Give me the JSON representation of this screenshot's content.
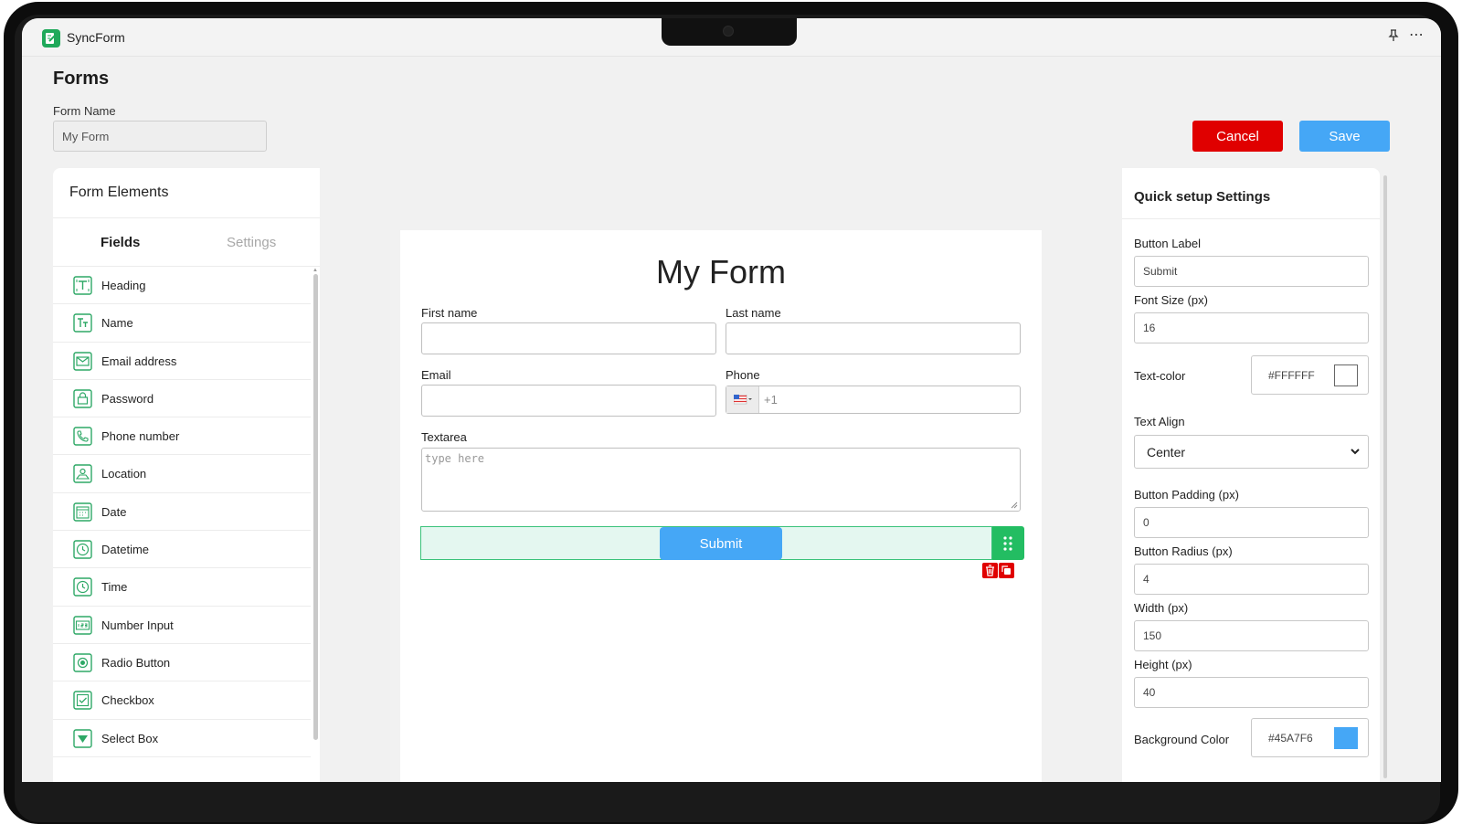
{
  "app": {
    "name": "SyncForm"
  },
  "page": {
    "title": "Forms",
    "form_name_label": "Form Name",
    "form_name_value": "My Form"
  },
  "actions": {
    "cancel_label": "Cancel",
    "save_label": "Save"
  },
  "left_panel": {
    "title": "Form Elements",
    "tabs": [
      {
        "label": "Fields",
        "active": true
      },
      {
        "label": "Settings",
        "active": false
      }
    ],
    "items": [
      {
        "label": "Heading",
        "icon": "heading-icon"
      },
      {
        "label": "Name",
        "icon": "text-icon"
      },
      {
        "label": "Email address",
        "icon": "envelope-icon"
      },
      {
        "label": "Password",
        "icon": "lock-icon"
      },
      {
        "label": "Phone number",
        "icon": "phone-icon"
      },
      {
        "label": "Location",
        "icon": "location-icon"
      },
      {
        "label": "Date",
        "icon": "calendar-icon"
      },
      {
        "label": "Datetime",
        "icon": "clock-icon"
      },
      {
        "label": "Time",
        "icon": "clock-icon"
      },
      {
        "label": "Number Input",
        "icon": "number-icon"
      },
      {
        "label": "Radio Button",
        "icon": "radio-icon"
      },
      {
        "label": "Checkbox",
        "icon": "checkbox-icon"
      },
      {
        "label": "Select Box",
        "icon": "select-icon"
      }
    ]
  },
  "canvas": {
    "title": "My Form",
    "first_name_label": "First name",
    "last_name_label": "Last name",
    "email_label": "Email",
    "phone_label": "Phone",
    "phone_prefix": "+1",
    "textarea_label": "Textarea",
    "textarea_placeholder": "type here",
    "submit_label": "Submit"
  },
  "right_panel": {
    "title": "Quick setup Settings",
    "button_label_label": "Button Label",
    "button_label_value": "Submit",
    "font_size_label": "Font Size (px)",
    "font_size_value": "16",
    "text_color_label": "Text-color",
    "text_color_value": "#FFFFFF",
    "text_align_label": "Text Align",
    "text_align_value": "Center",
    "padding_label": "Button Padding (px)",
    "padding_value": "0",
    "radius_label": "Button Radius (px)",
    "radius_value": "4",
    "width_label": "Width (px)",
    "width_value": "150",
    "height_label": "Height (px)",
    "height_value": "40",
    "bg_color_label": "Background Color",
    "bg_color_value": "#45A7F6"
  },
  "colors": {
    "accent_green": "#1fa95a",
    "danger": "#e00000",
    "primary": "#45a7f6"
  }
}
